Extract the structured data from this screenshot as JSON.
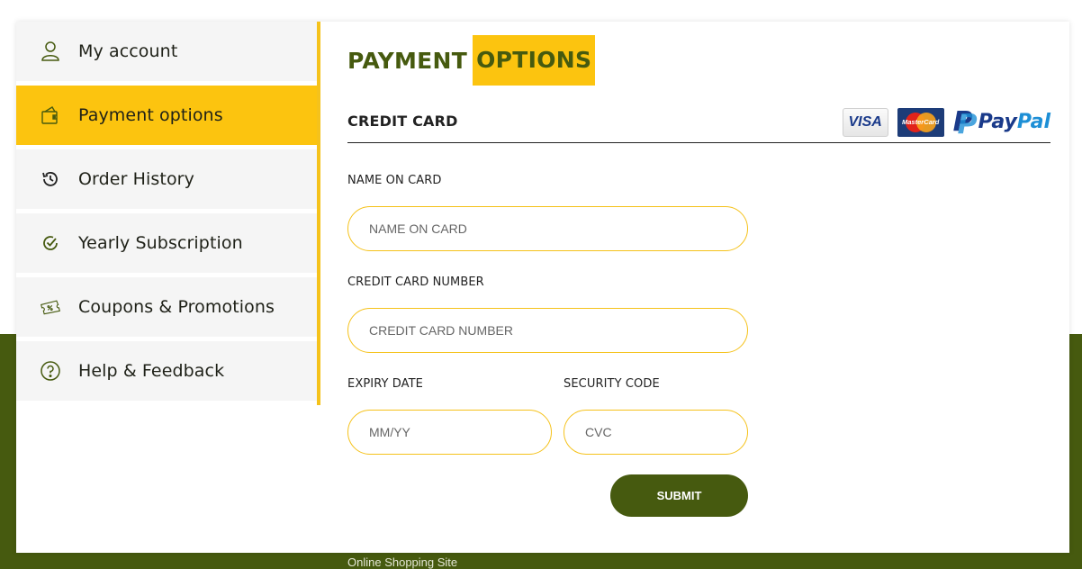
{
  "sidebar": {
    "items": [
      {
        "label": "My account",
        "icon": "user-icon",
        "active": false
      },
      {
        "label": "Payment options",
        "icon": "wallet-icon",
        "active": true
      },
      {
        "label": "Order History",
        "icon": "history-icon",
        "active": false
      },
      {
        "label": "Yearly Subscription",
        "icon": "check-circle-icon",
        "active": false
      },
      {
        "label": "Coupons & Promotions",
        "icon": "coupon-icon",
        "active": false
      },
      {
        "label": "Help & Feedback",
        "icon": "question-icon",
        "active": false
      }
    ]
  },
  "main": {
    "title_part1": "PAYMENT",
    "title_part2": "OPTIONS",
    "section_title": "CREDIT CARD",
    "logos": {
      "visa": "VISA",
      "mastercard": "MasterCard",
      "paypal_pay": "Pay",
      "paypal_pal": "Pal"
    },
    "fields": {
      "name_label": "NAME ON CARD",
      "name_placeholder": "NAME ON CARD",
      "number_label": "CREDIT CARD NUMBER",
      "number_placeholder": "CREDIT CARD NUMBER",
      "expiry_label": "EXPIRY DATE",
      "expiry_placeholder": "MM/YY",
      "cvc_label": "SECURITY CODE",
      "cvc_placeholder": "CVC"
    },
    "submit_label": "SUBMIT"
  },
  "footer": {
    "text": "Online Shopping Site"
  },
  "colors": {
    "accent_yellow": "#fcc40f",
    "brand_green": "#465a0f"
  }
}
